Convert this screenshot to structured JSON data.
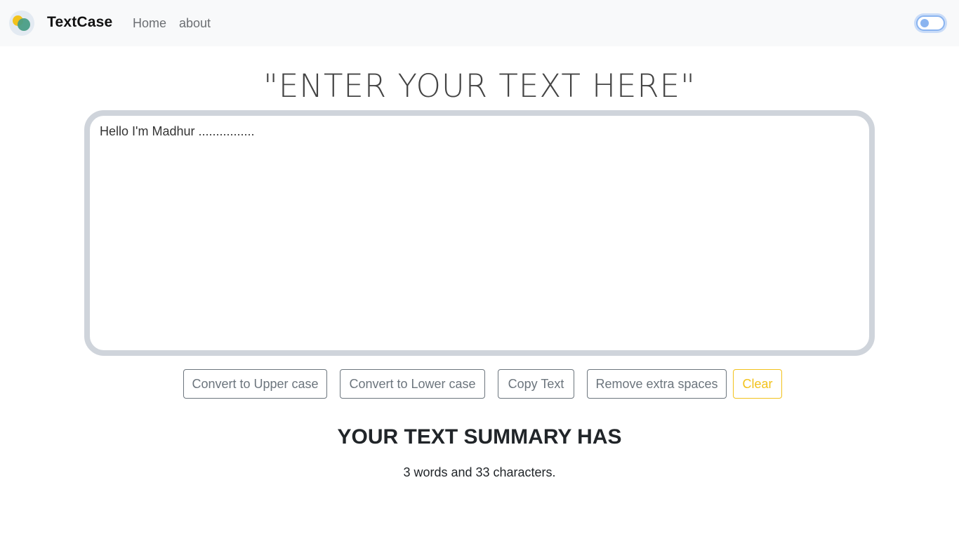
{
  "navbar": {
    "brand": "TextCase",
    "links": [
      {
        "label": "Home"
      },
      {
        "label": "about"
      }
    ],
    "logo_colors": {
      "yellow": "#f2c21b",
      "green": "#4a9e86"
    },
    "dark_mode_toggle": {
      "enabled": false
    }
  },
  "main": {
    "heading": "\"ENTER YOUR TEXT HERE\"",
    "textarea": {
      "value": "Hello I'm Madhur ................"
    },
    "buttons": {
      "upper": "Convert to Upper case",
      "lower": "Convert to Lower case",
      "copy": "Copy Text",
      "spaces": "Remove extra spaces",
      "clear": "Clear"
    },
    "summary": {
      "title": "YOUR TEXT SUMMARY HAS",
      "text": "3 words and 33 characters."
    }
  },
  "colors": {
    "button_secondary": "#6c757d",
    "button_warning": "#f2c21b",
    "textarea_border": "#cfd4db",
    "navbar_bg": "#f8f9fa"
  }
}
